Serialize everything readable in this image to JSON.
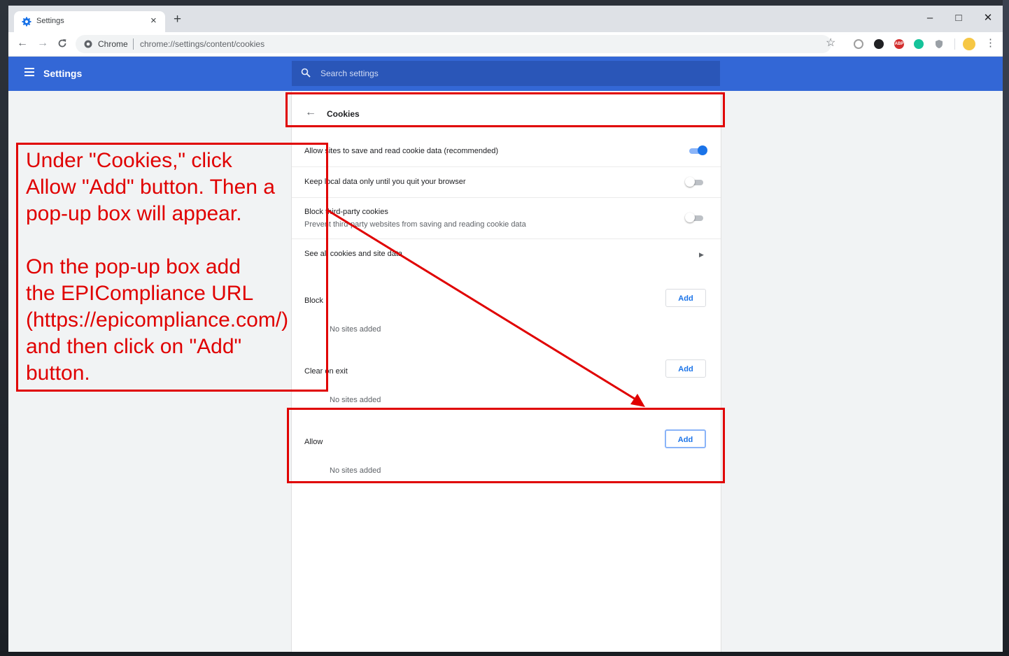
{
  "browser": {
    "tab_title": "Settings",
    "new_tab": "+",
    "window_buttons": {
      "minimize": "–",
      "maximize": "□",
      "close": "✕"
    },
    "nav": {
      "back": "←",
      "forward": "→",
      "reload": "C"
    },
    "omnibox": {
      "site_label": "Chrome",
      "url": "chrome://settings/content/cookies"
    },
    "star": "☆",
    "menu": "⋮",
    "extensions": [
      {
        "name": "ext-circle-icon",
        "color": "#9e9e9e"
      },
      {
        "name": "ext-dark-icon",
        "color": "#202124"
      },
      {
        "name": "adblock-plus-icon",
        "color": "#d32f2f",
        "text": "ABP"
      },
      {
        "name": "grammarly-icon",
        "color": "#15c39a"
      },
      {
        "name": "shield-ext-icon",
        "color": "#9aa0a6"
      },
      {
        "name": "profile-avatar-icon",
        "color": "#f6c744"
      }
    ]
  },
  "header": {
    "title": "Settings",
    "search_placeholder": "Search settings",
    "color": "#3367d6"
  },
  "page": {
    "title": "Cookies",
    "settings": [
      {
        "label": "Allow sites to save and read cookie data (recommended)",
        "enabled": true
      },
      {
        "label": "Keep local data only until you quit your browser",
        "enabled": false
      },
      {
        "label": "Block third-party cookies",
        "sub": "Prevent third-party websites from saving and reading cookie data",
        "enabled": false
      }
    ],
    "see_all": "See all cookies and site data",
    "sections": [
      {
        "label": "Block",
        "button": "Add",
        "empty": "No sites added"
      },
      {
        "label": "Clear on exit",
        "button": "Add",
        "empty": "No sites added"
      },
      {
        "label": "Allow",
        "button": "Add",
        "empty": "No sites added"
      }
    ]
  },
  "annotation": {
    "text": "Under \"Cookies,\" click\nAllow \"Add\" button. Then a\npop-up box will appear.\n\nOn the pop-up box add\nthe EPICompliance URL\n(https://epicompliance.com/)\nand then click on \"Add\"\nbutton.",
    "color": "#e00000"
  }
}
